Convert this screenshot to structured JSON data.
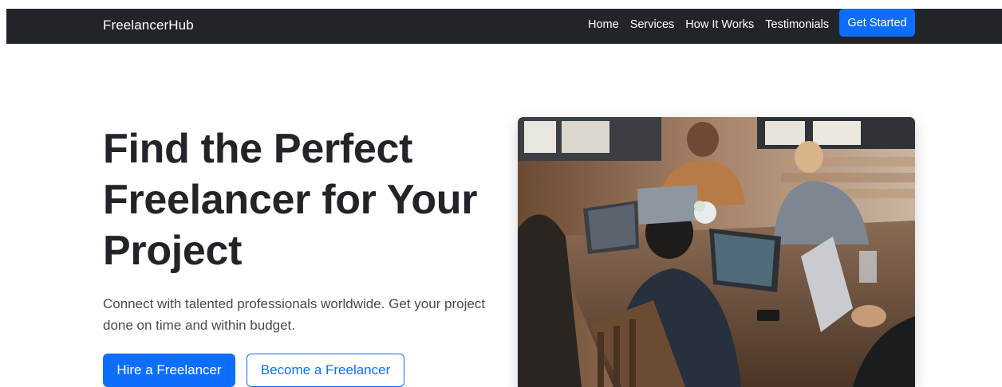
{
  "navbar": {
    "brand": "FreelancerHub",
    "links": [
      "Home",
      "Services",
      "How It Works",
      "Testimonials"
    ],
    "cta": "Get Started"
  },
  "hero": {
    "title": "Find the Perfect Freelancer for Your Project",
    "subtitle": "Connect with talented professionals worldwide. Get your project done on time and within budget.",
    "primary_button": "Hire a Freelancer",
    "secondary_button": "Become a Freelancer",
    "image_icon": "team-working-photo"
  },
  "colors": {
    "navbar_bg": "#212529",
    "accent": "#0d6efd",
    "text": "#212529"
  }
}
